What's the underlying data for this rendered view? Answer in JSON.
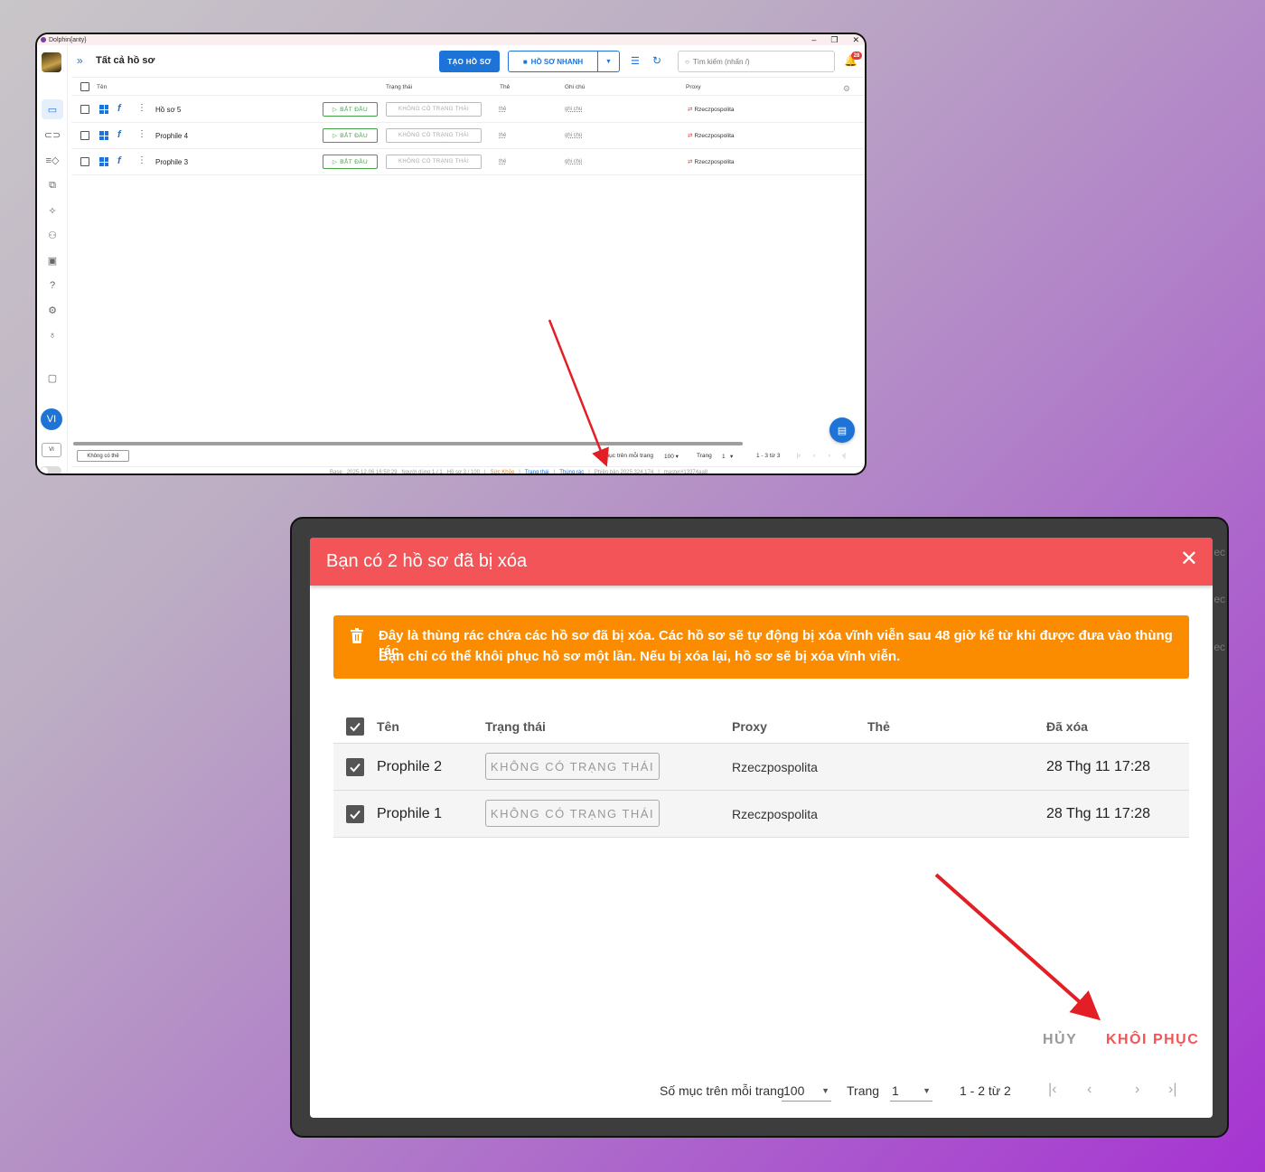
{
  "window1": {
    "app_title": "Dolphin{anty}",
    "window_controls": [
      "–",
      "❐",
      "✕"
    ],
    "header": {
      "page_title": "Tất cả hồ sơ",
      "create_label": "TẠO HỒ SƠ",
      "quick_label": "HỒ SƠ NHANH",
      "search_placeholder": "Tìm kiếm (nhấn /)",
      "notification_count": "28"
    },
    "columns": [
      "Tên",
      "Trạng thái",
      "Thẻ",
      "Ghi chú",
      "Proxy"
    ],
    "rows": [
      {
        "name": "Hồ sơ 5",
        "start": "BẮT ĐẦU",
        "status": "KHÔNG CÓ TRẠNG THÁI",
        "tag": "thẻ",
        "note": "ghi chú",
        "proxy": "Rzeczpospolita"
      },
      {
        "name": "Prophile 4",
        "start": "BẮT ĐẦU",
        "status": "KHÔNG CÓ TRẠNG THÁI",
        "tag": "thẻ",
        "note": "ghi chú",
        "proxy": "Rzeczpospolita"
      },
      {
        "name": "Prophile 3",
        "start": "BẮT ĐẦU",
        "status": "KHÔNG CÓ TRẠNG THÁI",
        "tag": "thẻ",
        "note": "ghi chú",
        "proxy": "Rzeczpospolita"
      }
    ],
    "sidebar": {
      "avatar": "VI",
      "lang": "VI",
      "icons": [
        "profiles-icon",
        "link-icon",
        "automation-icon",
        "copy-icon",
        "extensions-icon",
        "users-icon",
        "api-icon",
        "help-icon",
        "settings-icon",
        "idea-icon",
        "wallet-icon"
      ]
    },
    "footer": {
      "tag_filter": "Không có thẻ",
      "per_page_label": "Số mục trên mỗi trang",
      "per_page_value": "100",
      "page_label": "Trang",
      "page_value": "1",
      "range": "1 - 3 từ 3"
    },
    "statusbar": {
      "base": "Base",
      "datetime": "2025-12-06 16:50:29",
      "users": "Người dùng 1 / 1",
      "profiles": "Hồ sơ 3 / 100",
      "health": "Sức Khỏe",
      "status": "Trạng thái",
      "trash": "Thùng rác",
      "version": "Phiên bản 2025.324.174",
      "build": "master#13374aa8"
    }
  },
  "dialog": {
    "title": "Bạn có 2 hồ sơ đã bị xóa",
    "warning_line1": "Đây là thùng rác chứa các hồ sơ đã bị xóa. Các hồ sơ sẽ tự động bị xóa vĩnh viễn sau 48 giờ kể từ khi được đưa vào thùng rác.",
    "warning_line2": "Bạn chỉ có thể khôi phục hồ sơ một lần. Nếu bị xóa lại, hồ sơ sẽ bị xóa vĩnh viễn.",
    "columns": {
      "name": "Tên",
      "status": "Trạng thái",
      "proxy": "Proxy",
      "tag": "Thẻ",
      "deleted": "Đã xóa"
    },
    "rows": [
      {
        "name": "Prophile 2",
        "status": "KHÔNG CÓ TRẠNG THÁI",
        "proxy": "Rzeczpospolita",
        "tag": "",
        "deleted": "28 Thg 11 17:28",
        "checked": true
      },
      {
        "name": "Prophile 1",
        "status": "KHÔNG CÓ TRẠNG THÁI",
        "proxy": "Rzeczpospolita",
        "tag": "",
        "deleted": "28 Thg 11 17:28",
        "checked": true
      }
    ],
    "cancel_label": "HỦY",
    "restore_label": "KHÔI PHỤC",
    "pager": {
      "per_page_label": "Số mục trên mỗi trang",
      "per_page_value": "100",
      "page_label": "Trang",
      "page_value": "1",
      "range": "1 - 2 từ 2"
    }
  },
  "colors": {
    "primary": "#1e73d6",
    "dialog_header": "#f25457",
    "warning": "#fb8c00",
    "start_green": "#43a047",
    "annotation_arrow": "#e31e24"
  }
}
